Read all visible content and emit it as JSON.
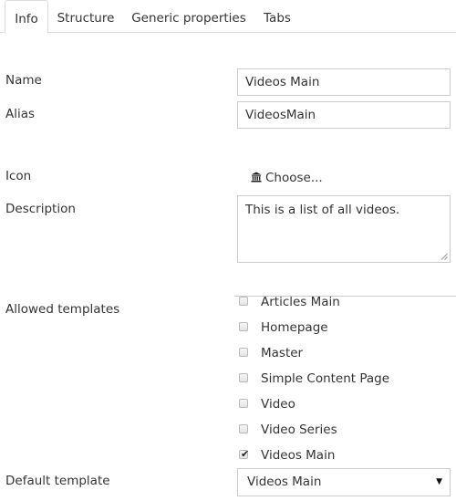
{
  "tabs": [
    {
      "label": "Info",
      "active": true
    },
    {
      "label": "Structure",
      "active": false
    },
    {
      "label": "Generic properties",
      "active": false
    },
    {
      "label": "Tabs",
      "active": false
    }
  ],
  "form": {
    "name_label": "Name",
    "name_value": "Videos Main",
    "alias_label": "Alias",
    "alias_value": "VideosMain",
    "icon_label": "Icon",
    "icon_choose": "Choose...",
    "icon_name": "building-columns-icon",
    "description_label": "Description",
    "description_value": "This is a list of all videos.",
    "allowed_templates_label": "Allowed templates",
    "templates": [
      {
        "label": "Articles Main",
        "checked": false
      },
      {
        "label": "Homepage",
        "checked": false
      },
      {
        "label": "Master",
        "checked": false
      },
      {
        "label": "Simple Content Page",
        "checked": false
      },
      {
        "label": "Video",
        "checked": false
      },
      {
        "label": "Video Series",
        "checked": false
      },
      {
        "label": "Videos Main",
        "checked": true
      }
    ],
    "default_template_label": "Default template",
    "default_template_value": "Videos Main",
    "default_template_arrow": "▼"
  },
  "colors": {
    "text": "#343434",
    "border": "#cccccc",
    "tab_border": "#dddddd"
  }
}
